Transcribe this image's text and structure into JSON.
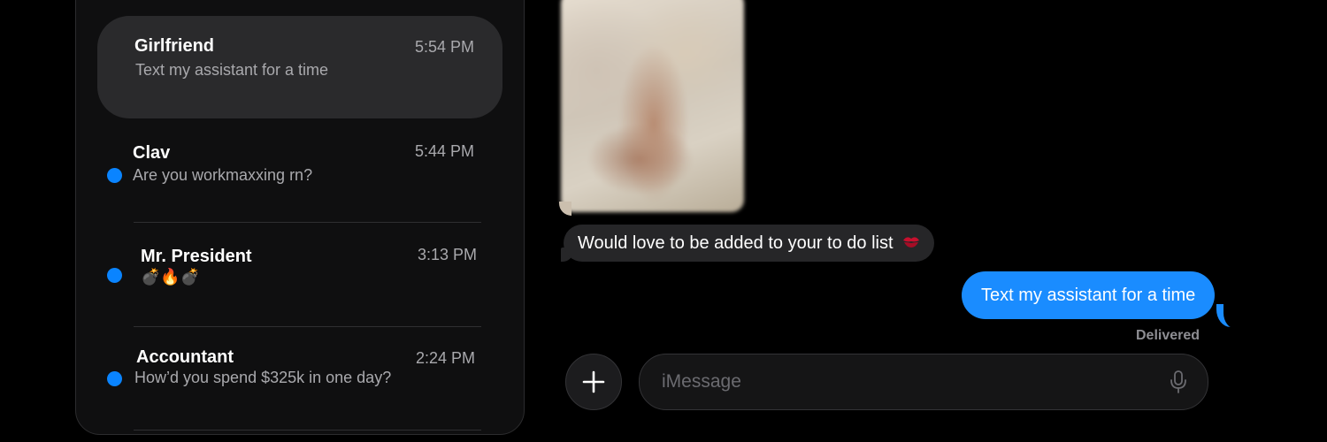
{
  "conversations": [
    {
      "name": "Girlfriend",
      "time": "5:54 PM",
      "preview": "Text my assistant for a time",
      "unread": false,
      "selected": true
    },
    {
      "name": "Clav",
      "time": "5:44 PM",
      "preview": "Are you workmaxxing rn?",
      "unread": true
    },
    {
      "name": "Mr. President",
      "time": "3:13 PM",
      "preview": "💣🔥💣",
      "unread": true
    },
    {
      "name": "Accountant",
      "time": "2:24 PM",
      "preview": "How’d you spend $325k in one day?",
      "unread": true
    }
  ],
  "messages": {
    "photo_icon": "blurred-photo",
    "received": "Would love to be added to your to do list",
    "received_emoji_icon": "kiss-mark-icon",
    "sent": "Text my assistant for a time",
    "status": "Delivered"
  },
  "composer": {
    "placeholder": "iMessage",
    "add_icon": "plus-icon",
    "mic_icon": "microphone-icon"
  },
  "colors": {
    "accent": "#0a84ff",
    "sent_bubble": "#1a8cff",
    "received_bubble": "#262628",
    "background": "#000000"
  }
}
